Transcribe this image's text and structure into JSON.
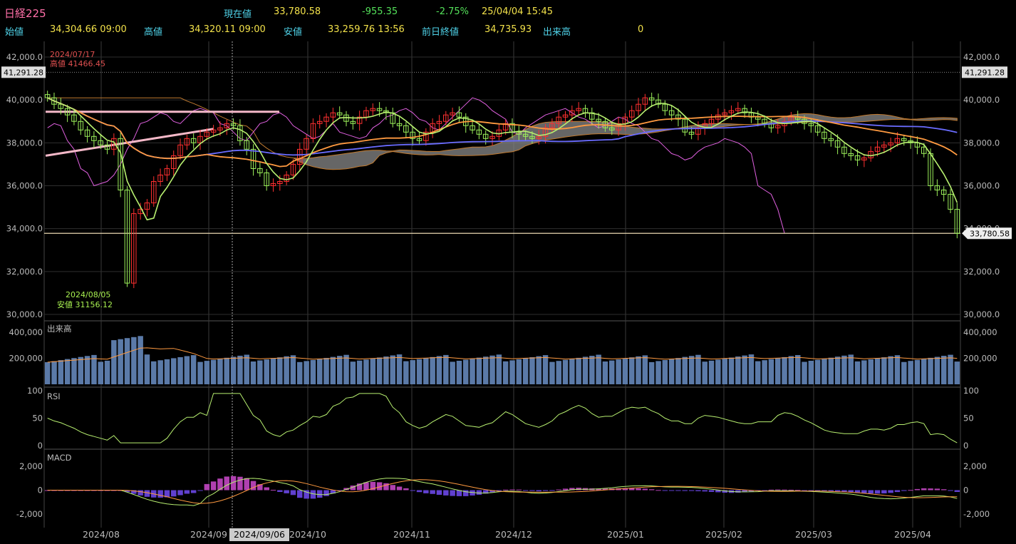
{
  "header": {
    "title": "日経225",
    "current_label": "現在値",
    "current_value": "33,780.58",
    "change": "-955.35",
    "change_pct": "-2.75%",
    "datetime": "25/04/04  15:45",
    "open_label": "始値",
    "open_value": "34,304.66 09:00",
    "high_label": "高値",
    "high_value": "34,320.11 09:00",
    "low_label": "安値",
    "low_value": "33,259.76 13:56",
    "prev_close_label": "前日終値",
    "prev_close_value": "34,735.93",
    "volume_label": "出来高",
    "volume_value": "0"
  },
  "colors": {
    "up": "#ff3030",
    "down": "#9cf05a",
    "ma_short": "#b8f070",
    "ma_mid": "#ff9a40",
    "ma_long": "#6a6cff",
    "lag_span": "#e060e0",
    "cloud": "#888888",
    "volume": "#5b7aa8"
  },
  "chart_data": [
    {
      "type": "candlestick",
      "x_ticks": [
        "2024/08",
        "2024/09",
        "2024/10",
        "2024/11",
        "2024/12",
        "2025/01",
        "2025/02",
        "2025/03",
        "2025/04"
      ],
      "y_ticks": [
        "42,000.0",
        "40,000.0",
        "38,000.0",
        "36,000.0",
        "34,000.0",
        "32,000.0",
        "30,000.0"
      ],
      "ylim": [
        30000,
        42000
      ],
      "crosshair_date": "2024/09/06",
      "ref_label": "41,291.28",
      "last_label": "33,780.58",
      "high_annotation": {
        "date": "2024/07/17",
        "text": "高値 41466.45"
      },
      "low_annotation": {
        "date": "2024/08/05",
        "text": "安値 31156.12"
      },
      "closes": [
        40100,
        39800,
        39600,
        39300,
        39000,
        38600,
        38300,
        38100,
        37900,
        37700,
        38200,
        35800,
        31458,
        34700,
        34900,
        35200,
        36200,
        36500,
        36800,
        37400,
        37900,
        38200,
        38000,
        38300,
        38500,
        38600,
        38700,
        38900,
        38800,
        38100,
        37700,
        36800,
        36600,
        36000,
        36100,
        36200,
        36500,
        37000,
        37700,
        38200,
        38900,
        39000,
        39200,
        39400,
        39300,
        39000,
        38900,
        39200,
        39500,
        39600,
        39500,
        39400,
        38900,
        38800,
        38500,
        38200,
        38100,
        38500,
        38900,
        39000,
        39300,
        39400,
        39200,
        38800,
        38600,
        38400,
        38200,
        38300,
        38600,
        38900,
        38500,
        38400,
        38300,
        38200,
        38300,
        38700,
        38900,
        39200,
        39300,
        39500,
        39600,
        39400,
        39100,
        39000,
        38700,
        38600,
        38900,
        39200,
        39500,
        39800,
        40100,
        40000,
        39800,
        39500,
        39300,
        39100,
        38500,
        38400,
        38700,
        38900,
        39100,
        39300,
        39400,
        39500,
        39600,
        39400,
        39200,
        39100,
        38900,
        38700,
        38800,
        39000,
        39200,
        39100,
        38900,
        38800,
        38500,
        38200,
        38100,
        37800,
        37500,
        37400,
        37200,
        37300,
        37600,
        37800,
        37900,
        38000,
        38200,
        38100,
        38000,
        37800,
        37500,
        36000,
        35800,
        35600,
        34900,
        33780.58
      ],
      "volume": {
        "label": "出来高",
        "y_ticks": [
          "400,000",
          "200,000"
        ],
        "ylim": [
          0,
          400000
        ]
      },
      "rsi": {
        "label": "RSI",
        "y_ticks": [
          "100",
          "50",
          "0"
        ],
        "ylim": [
          0,
          100
        ]
      },
      "macd": {
        "label": "MACD",
        "y_ticks": [
          "2,000",
          "0",
          "-2,000"
        ],
        "ylim": [
          -2500,
          2500
        ]
      }
    }
  ]
}
